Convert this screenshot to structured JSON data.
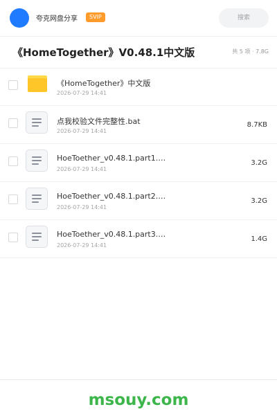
{
  "header": {
    "brand": "夸克网盘分享",
    "vip_badge": "SVIP",
    "search_label": "搜索"
  },
  "title_bar": {
    "title": "《HomeTogether》V0.48.1中文版",
    "summary": "共 5 项 · 7.8G"
  },
  "files": [
    {
      "type": "folder",
      "name": "《HomeTogether》中文版",
      "date": "2026-07-29 14:41",
      "size": ""
    },
    {
      "type": "file",
      "name": "点我校验文件完整性.bat",
      "date": "2026-07-29 14:41",
      "size": "8.7KB"
    },
    {
      "type": "file",
      "name": "HoeToether_v0.48.1.part1.…",
      "date": "2026-07-29 14:41",
      "size": "3.2G"
    },
    {
      "type": "file",
      "name": "HoeToether_v0.48.1.part2.…",
      "date": "2026-07-29 14:41",
      "size": "3.2G"
    },
    {
      "type": "file",
      "name": "HoeToether_v0.48.1.part3.…",
      "date": "2026-07-29 14:41",
      "size": "1.4G"
    }
  ],
  "watermark": "msouy.com",
  "colors": {
    "accent": "#1f7bff",
    "vip": "#ff9b2b",
    "folder": "#ffc629",
    "watermark": "#3cb54a"
  },
  "icons": {
    "avatar": "avatar-circle",
    "folder": "folder-icon",
    "file": "document-icon"
  }
}
